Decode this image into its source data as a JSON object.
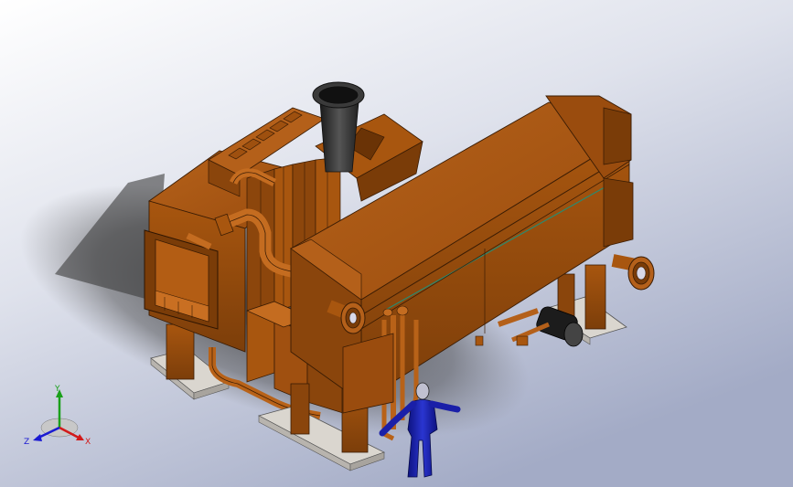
{
  "viewport": {
    "background_gradient": [
      "#ffffff",
      "#d9dce8",
      "#9ea7c4"
    ],
    "shadow_color": "#3a3a3a"
  },
  "model": {
    "description_type": "cad-3d-model",
    "body_color": "#a4520f",
    "body_dark": "#6e360a",
    "body_light": "#c26a1e",
    "stack_color": "#2a2a2a",
    "base_color": "#d8d4cc",
    "figure_color": "#1a1fa8",
    "pipe_line_color": "#2a8a70"
  },
  "triad": {
    "x_label": "X",
    "y_label": "Y",
    "z_label": "Z",
    "x_color": "#d21a1a",
    "y_color": "#1aa01a",
    "z_color": "#1a1ad2"
  }
}
